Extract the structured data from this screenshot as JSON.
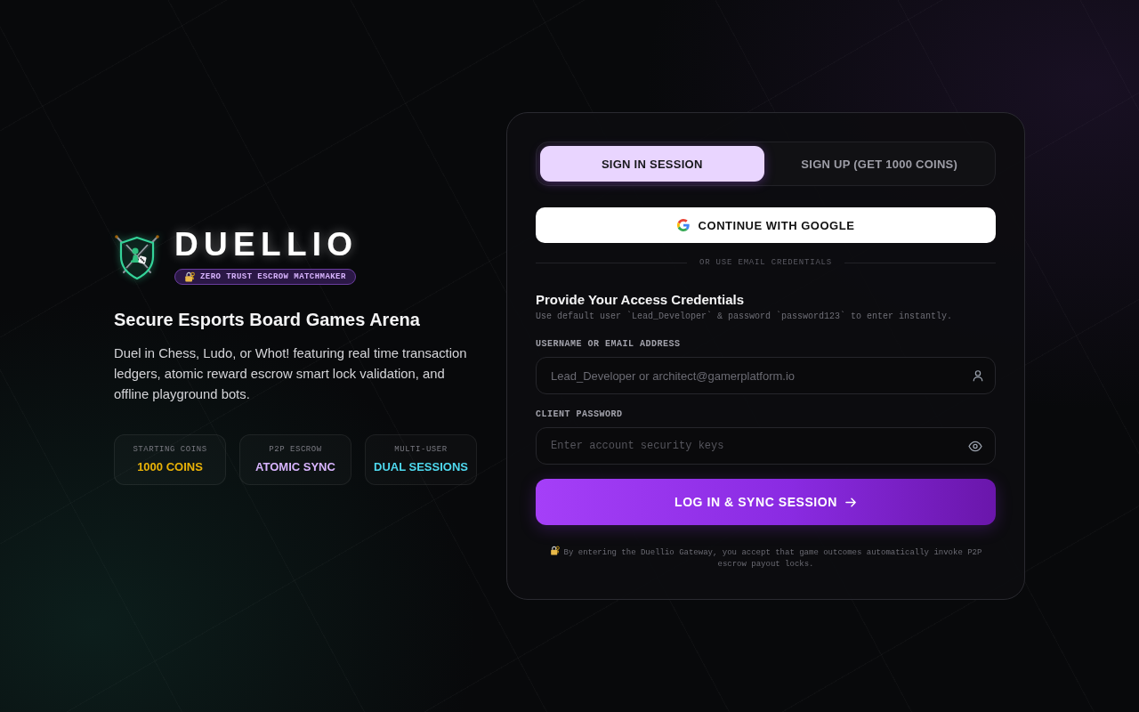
{
  "brand": {
    "name": "DUELLIO",
    "badge": "ZERO TRUST ESCROW MATCHMAKER"
  },
  "hero": {
    "heading": "Secure Esports Board Games Arena",
    "description": "Duel in Chess, Ludo, or Whot! featuring real time transaction ledgers, atomic reward escrow smart lock validation, and offline playground bots."
  },
  "stats": [
    {
      "label": "STARTING COINS",
      "value": "1000 COINS",
      "color": "#eab308"
    },
    {
      "label": "P2P ESCROW",
      "value": "ATOMIC SYNC",
      "color": "#d8b4fe"
    },
    {
      "label": "MULTI-USER",
      "value": "DUAL SESSIONS",
      "color": "#4fd9ef"
    }
  ],
  "auth_card": {
    "tabs": [
      {
        "label": "SIGN IN SESSION",
        "selected": true
      },
      {
        "label": "SIGN UP (GET 1000 COINS)",
        "selected": false
      }
    ],
    "google_button": {
      "label": "CONTINUE WITH GOOGLE"
    },
    "divider": "OR USE EMAIL CREDENTIALS",
    "form_title": "Provide Your Access Credentials",
    "form_hint": "Use default user `Lead_Developer` & password `password123` to enter instantly.",
    "fields": [
      {
        "kind": "username",
        "label": "USERNAME OR EMAIL ADDRESS",
        "placeholder": "Lead_Developer or architect@gamerplatform.io"
      },
      {
        "kind": "password",
        "label": "CLIENT PASSWORD",
        "placeholder": "Enter account security keys"
      }
    ],
    "submit_button": {
      "label": "LOG IN & SYNC SESSION"
    },
    "disclaimer": "By entering the Duellio Gateway, you accept that game outcomes automatically invoke P2P escrow payout locks."
  }
}
